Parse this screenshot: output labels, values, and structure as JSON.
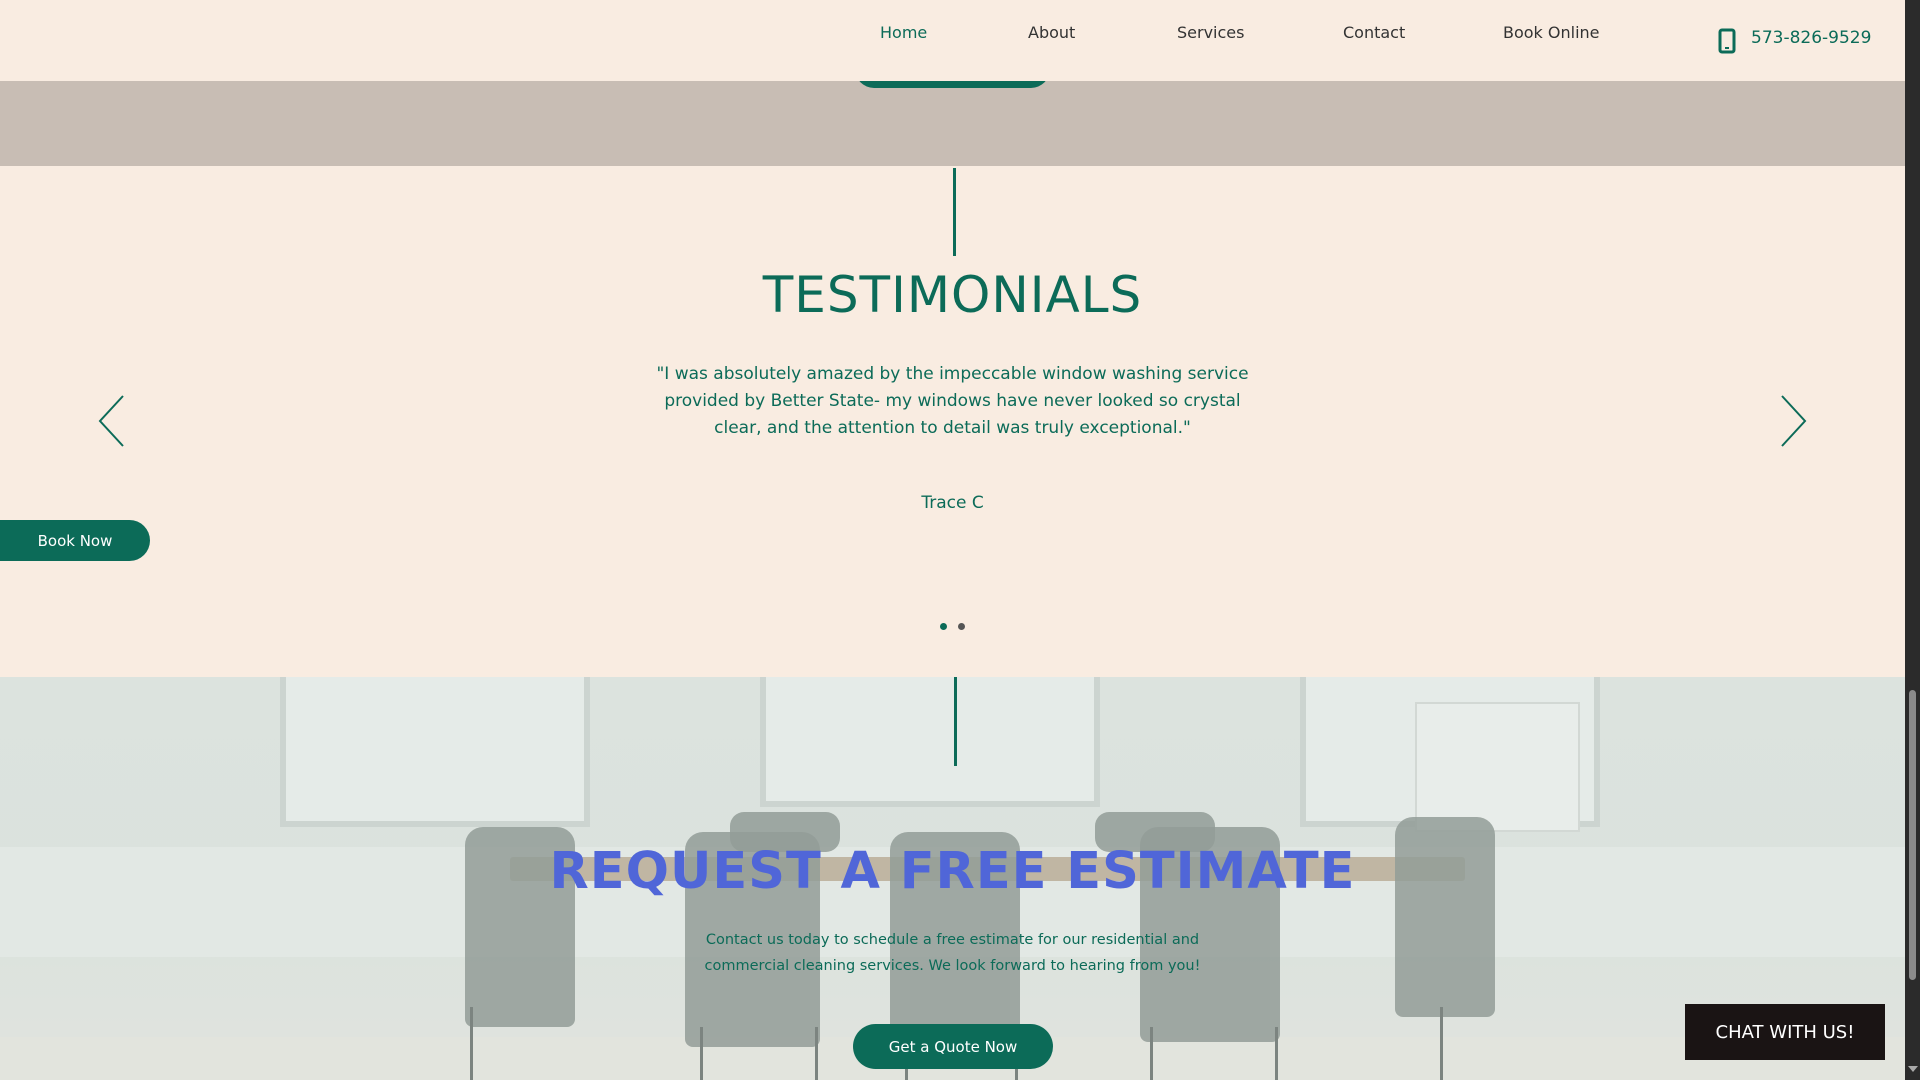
{
  "nav": {
    "items": [
      {
        "label": "Home",
        "active": true
      },
      {
        "label": "About",
        "active": false
      },
      {
        "label": "Services",
        "active": false
      },
      {
        "label": "Contact",
        "active": false
      },
      {
        "label": "Book Online",
        "active": false
      }
    ],
    "phone": "573-826-9529",
    "phone_icon": "phone-icon"
  },
  "testimonials": {
    "title": "TESTIMONIALS",
    "quote": "\"I was absolutely amazed by the impeccable window washing service provided by Better State- my windows have never looked so crystal clear, and the attention to detail was truly exceptional.\"",
    "author": "Trace C",
    "prev_icon": "chevron-left-icon",
    "next_icon": "chevron-right-icon",
    "slide_count": 2,
    "active_slide": 1
  },
  "book_now_label": "Book Now",
  "estimate": {
    "title": "REQUEST A FREE ESTIMATE",
    "text": "Contact us today to schedule a free estimate for our residential and commercial cleaning services. We look forward to hearing from you!",
    "button_label": "Get a Quote Now"
  },
  "chat_label": "CHAT WITH US!",
  "colors": {
    "brand": "#0c6b58",
    "background": "#f9ece1",
    "band": "#c8bdb4",
    "estimate_title": "#5066d8",
    "chat_bg": "#1a1414"
  }
}
